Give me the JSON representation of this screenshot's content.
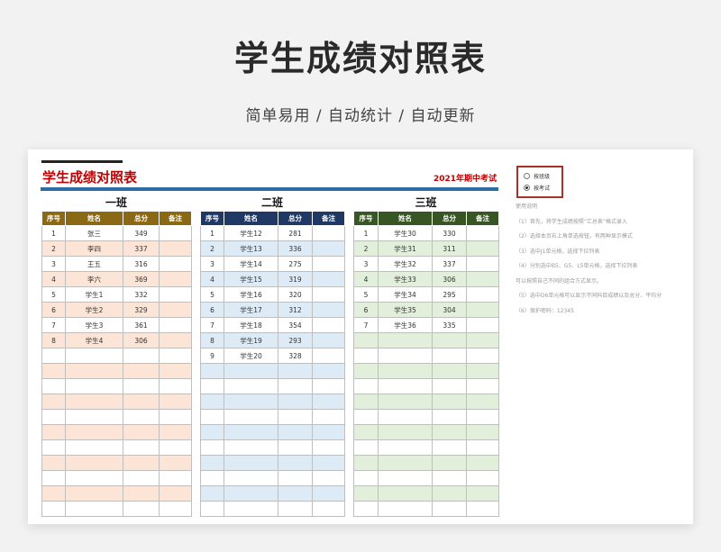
{
  "hero": {
    "title": "学生成绩对照表",
    "subtitle": "简单易用  /  自动统计  /  自动更新"
  },
  "sheet": {
    "title": "学生成绩对照表",
    "exam_label": "2021年期中考试"
  },
  "headers": [
    "序号",
    "姓名",
    "总分",
    "备注"
  ],
  "classes": [
    {
      "name": "一班",
      "rows": [
        {
          "no": "1",
          "name": "张三",
          "score": "349"
        },
        {
          "no": "2",
          "name": "李四",
          "score": "337"
        },
        {
          "no": "3",
          "name": "王五",
          "score": "316"
        },
        {
          "no": "4",
          "name": "李六",
          "score": "369"
        },
        {
          "no": "5",
          "name": "学生1",
          "score": "332"
        },
        {
          "no": "6",
          "name": "学生2",
          "score": "329"
        },
        {
          "no": "7",
          "name": "学生3",
          "score": "361"
        },
        {
          "no": "8",
          "name": "学生4",
          "score": "306"
        }
      ]
    },
    {
      "name": "二班",
      "rows": [
        {
          "no": "1",
          "name": "学生12",
          "score": "281"
        },
        {
          "no": "2",
          "name": "学生13",
          "score": "336"
        },
        {
          "no": "3",
          "name": "学生14",
          "score": "275"
        },
        {
          "no": "4",
          "name": "学生15",
          "score": "319"
        },
        {
          "no": "5",
          "name": "学生16",
          "score": "320"
        },
        {
          "no": "6",
          "name": "学生17",
          "score": "312"
        },
        {
          "no": "7",
          "name": "学生18",
          "score": "354"
        },
        {
          "no": "8",
          "name": "学生19",
          "score": "293"
        },
        {
          "no": "9",
          "name": "学生20",
          "score": "328"
        }
      ]
    },
    {
      "name": "三班",
      "rows": [
        {
          "no": "1",
          "name": "学生30",
          "score": "330"
        },
        {
          "no": "2",
          "name": "学生31",
          "score": "311"
        },
        {
          "no": "3",
          "name": "学生32",
          "score": "337"
        },
        {
          "no": "4",
          "name": "学生33",
          "score": "306"
        },
        {
          "no": "5",
          "name": "学生34",
          "score": "295"
        },
        {
          "no": "6",
          "name": "学生35",
          "score": "304"
        },
        {
          "no": "7",
          "name": "学生36",
          "score": "335"
        }
      ]
    }
  ],
  "radio": {
    "option1": "按班级",
    "option2": "按考试",
    "selected": "option2"
  },
  "notes": {
    "title": "使用说明",
    "items": [
      "（1）首先，将学生成绩按照“汇总表”格式录入",
      "（2）选择本页右上角单选按钮，有两种显示模式",
      "（3）选中J1单元格，选择下拉列表",
      "（4）分别选中B5、G5、L5单元格，选择下拉列表",
      "可以按照自己不同的组合方式显示。",
      "（5）选中D6单元格可以显示不同科目成绩以及总分、平均分",
      "（6）保护密码：12345"
    ]
  },
  "colors": {
    "class1_header": "#8b6914",
    "class2_header": "#1f3864",
    "class3_header": "#375623",
    "title_red": "#c00000",
    "rule_blue": "#2e6da4"
  }
}
